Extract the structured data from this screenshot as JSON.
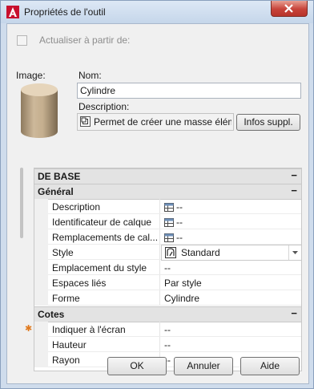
{
  "window": {
    "title": "Propriétés de l'outil"
  },
  "update": {
    "label": "Actualiser à partir de:",
    "checked": false
  },
  "image": {
    "label": "Image:"
  },
  "name": {
    "label": "Nom:",
    "value": "Cylindre"
  },
  "description": {
    "label": "Description:",
    "value": "Permet de créer une masse élém"
  },
  "more_info_button": "Infos suppl.",
  "grid": {
    "header": "DE BASE",
    "header_mark": "−",
    "sections": [
      {
        "title": "Général",
        "mark": "−",
        "rows": [
          {
            "name": "Description",
            "value": "--",
            "icon": "table-icon"
          },
          {
            "name": "Identificateur de calque",
            "value": "--",
            "icon": "table-icon"
          },
          {
            "name": "Remplacements de cal...",
            "value": "--",
            "icon": "table-icon"
          },
          {
            "name": "Style",
            "value": "Standard",
            "icon": "style-icon",
            "dropdown": true
          },
          {
            "name": "Emplacement du style",
            "value": "--"
          },
          {
            "name": "Espaces liés",
            "value": "Par style"
          },
          {
            "name": "Forme",
            "value": "Cylindre"
          }
        ]
      },
      {
        "title": "Cotes",
        "mark": "−",
        "rows": [
          {
            "name": "Indiquer à l'écran",
            "value": "--",
            "asterisk": "✱"
          },
          {
            "name": "Hauteur",
            "value": "--"
          },
          {
            "name": "Rayon",
            "value": "--"
          }
        ]
      }
    ]
  },
  "buttons": {
    "ok": "OK",
    "cancel": "Annuler",
    "help": "Aide"
  },
  "colors": {
    "accent": "#c7433a",
    "category_bg": "#e3e3e3",
    "asterisk": "#e07a1f"
  }
}
